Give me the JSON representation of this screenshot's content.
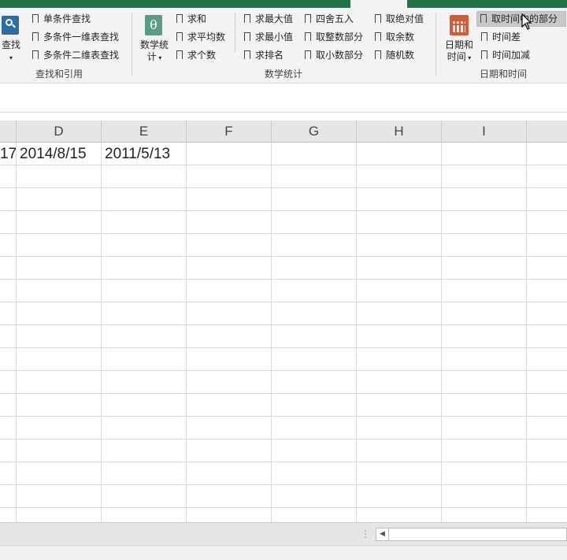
{
  "ribbon": {
    "find_group": {
      "button_label": "查找",
      "items": [
        "单条件查找",
        "多条件一维表查找",
        "多条件二维表查找"
      ],
      "group_label": "查找和引用"
    },
    "math_group": {
      "button_label_line1": "数学统",
      "button_label_line2": "计",
      "col1": [
        "求和",
        "求平均数",
        "求个数"
      ],
      "col2": [
        "求最大值",
        "求最小值",
        "求排名"
      ],
      "col3": [
        "四舍五入",
        "取整数部分",
        "取小数部分"
      ],
      "col4": [
        "取绝对值",
        "取余数",
        "随机数"
      ],
      "group_label": "数学统计"
    },
    "datetime_group": {
      "button_label_line1": "日期和",
      "button_label_line2": "时间",
      "items": [
        "取时间中的部分",
        "时间差",
        "时间加减"
      ],
      "group_label": "日期和时间"
    }
  },
  "sheet": {
    "column_headers": [
      "D",
      "E",
      "F",
      "G",
      "H",
      "I"
    ],
    "row1": {
      "c_partial": "17",
      "d": "2014/8/15",
      "e": "2011/5/13"
    }
  },
  "colors": {
    "title_green": "#217346",
    "ribbon_bg": "#f3f3f3",
    "header_bg": "#e6e6e6"
  }
}
